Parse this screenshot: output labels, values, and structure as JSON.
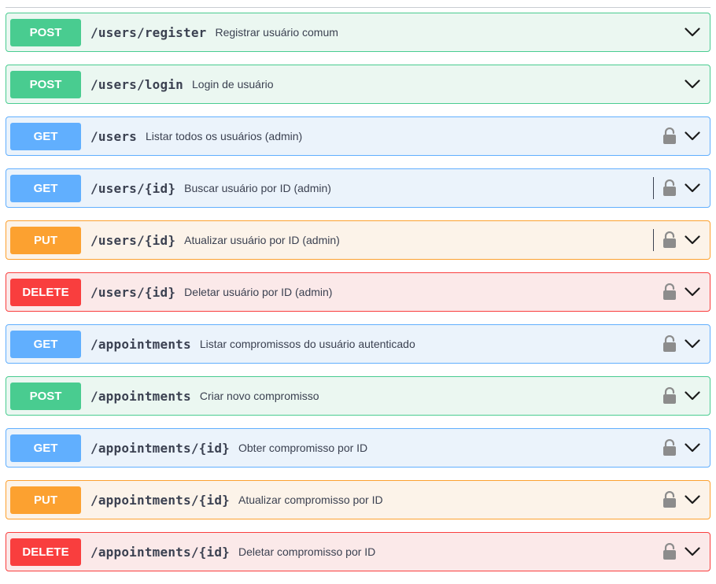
{
  "operations": [
    {
      "method": "POST",
      "path": "/users/register",
      "summary": "Registrar usuário comum",
      "lock_icon": false,
      "separator": false
    },
    {
      "method": "POST",
      "path": "/users/login",
      "summary": "Login de usuário",
      "lock_icon": false,
      "separator": false
    },
    {
      "method": "GET",
      "path": "/users",
      "summary": "Listar todos os usuários (admin)",
      "lock_icon": true,
      "separator": false
    },
    {
      "method": "GET",
      "path": "/users/{id}",
      "summary": "Buscar usuário por ID (admin)",
      "lock_icon": true,
      "separator": true
    },
    {
      "method": "PUT",
      "path": "/users/{id}",
      "summary": "Atualizar usuário por ID (admin)",
      "lock_icon": true,
      "separator": true
    },
    {
      "method": "DELETE",
      "path": "/users/{id}",
      "summary": "Deletar usuário por ID (admin)",
      "lock_icon": true,
      "separator": false
    },
    {
      "method": "GET",
      "path": "/appointments",
      "summary": "Listar compromissos do usuário autenticado",
      "lock_icon": true,
      "separator": false
    },
    {
      "method": "POST",
      "path": "/appointments",
      "summary": "Criar novo compromisso",
      "lock_icon": true,
      "separator": false
    },
    {
      "method": "GET",
      "path": "/appointments/{id}",
      "summary": "Obter compromisso por ID",
      "lock_icon": true,
      "separator": false
    },
    {
      "method": "PUT",
      "path": "/appointments/{id}",
      "summary": "Atualizar compromisso por ID",
      "lock_icon": true,
      "separator": false
    },
    {
      "method": "DELETE",
      "path": "/appointments/{id}",
      "summary": "Deletar compromisso por ID",
      "lock_icon": true,
      "separator": false
    }
  ],
  "icons": {
    "lock": "unlocked-padlock-icon",
    "expand": "chevron-down-icon"
  },
  "colors": {
    "post": "#49cc90",
    "get": "#61affe",
    "put": "#fca130",
    "delete": "#f93e3e",
    "text": "#3b4151",
    "lock": "#8c8c8c"
  }
}
